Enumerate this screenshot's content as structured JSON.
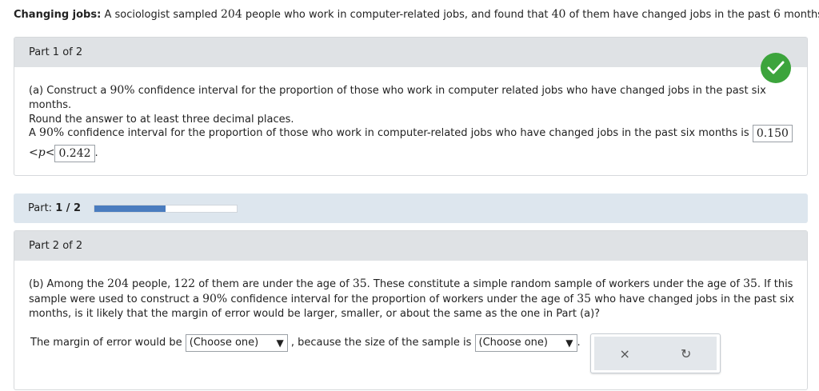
{
  "intro": {
    "title": "Changing jobs:",
    "text_a": " A sociologist sampled ",
    "n": "204",
    "text_b": " people who work in computer-related jobs, and found that ",
    "x": "40",
    "text_c": " of them have changed jobs in the past ",
    "months": "6",
    "text_d": " months."
  },
  "part1": {
    "header": "Part 1 of 2",
    "q_a": "(a) Construct a ",
    "q_pct": "90%",
    "q_b": " confidence interval for the proportion of those who work in computer related jobs who have changed jobs in the past six months.",
    "q_line2": "Round the answer to at least three decimal places.",
    "ans_a": "A ",
    "ans_pct": "90%",
    "ans_b": " confidence interval for the proportion of those who work in computer-related jobs who have changed jobs in the past six months is ",
    "lower": "0.150",
    "ineq": "<p<",
    "upper": "0.242",
    "period": "."
  },
  "progress": {
    "label_prefix": "Part: ",
    "label_value": "1 / 2",
    "fraction": 0.5,
    "fill_color": "#4a7cbf"
  },
  "part2": {
    "header": "Part 2 of 2",
    "q_a": "(b) Among the ",
    "q_n": "204",
    "q_b": " people, ",
    "q_k": "122",
    "q_c": " of them are under the age of ",
    "q_age": "35",
    "q_d": ". These constitute a simple random sample of workers under the age of ",
    "q_age2": "35",
    "q_e": ". If this",
    "q_line2_a": "sample were used to construct a ",
    "q_pct": "90%",
    "q_line2_b": " confidence interval for the proportion of workers under the age of ",
    "q_age3": "35",
    "q_line2_c": " who have changed jobs in the past six",
    "q_line3": "months, is it likely that the margin of error would be larger, smaller, or about the same as the one in Part (a)?",
    "moe_a": "The margin of error would be ",
    "select1": "(Choose one)",
    "moe_b": " , because the size of the sample is ",
    "select2": "(Choose one)",
    "moe_c": "."
  },
  "tools": {
    "clear_icon": "×",
    "undo_icon": "↻"
  },
  "colors": {
    "check": "#3ca43c",
    "header_bg": "#dfe2e5",
    "progress_bg": "#dde6ee"
  }
}
